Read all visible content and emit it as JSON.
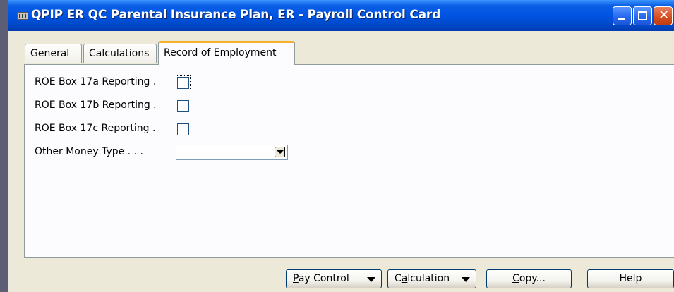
{
  "window": {
    "title": "QPIP ER QC Parental Insurance Plan, ER - Payroll Control Card"
  },
  "tabs": [
    {
      "label": "General"
    },
    {
      "label": "Calculations"
    },
    {
      "label": "Record of Employment",
      "active": true
    }
  ],
  "fields": {
    "roe_17a": {
      "label": "ROE Box 17a Reporting .",
      "checked": false
    },
    "roe_17b": {
      "label": "ROE Box 17b Reporting .",
      "checked": false
    },
    "roe_17c": {
      "label": "ROE Box 17c Reporting .",
      "checked": false
    },
    "other_money_type": {
      "label": "Other Money Type . . .",
      "value": ""
    }
  },
  "buttons": {
    "pay_control": {
      "mnemonic": "P",
      "rest": "ay Control"
    },
    "calculation": {
      "pre": "C",
      "mnemonic": "a",
      "rest": "lculation"
    },
    "copy": {
      "mnemonic": "C",
      "rest": "opy..."
    },
    "help": {
      "label": "Help"
    }
  },
  "icons": {
    "app": "app-icon",
    "minimize": "minimize-icon",
    "maximize": "maximize-icon",
    "close": "close-icon",
    "dropdown": "chevron-down-icon"
  },
  "colors": {
    "titlebar": "#0054e3",
    "active_tab_accent": "#f5b12d",
    "window_bg": "#ece9d8"
  }
}
